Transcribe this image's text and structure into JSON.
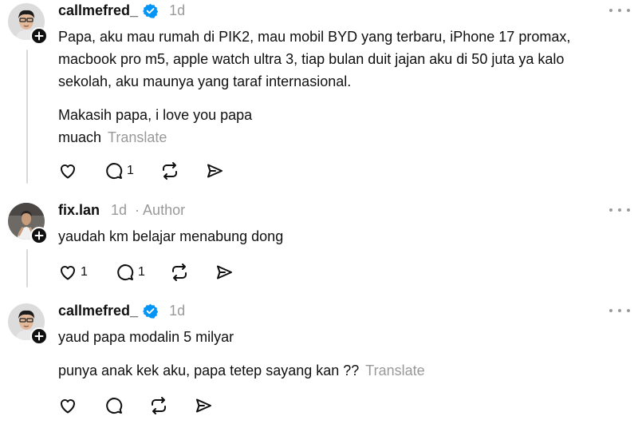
{
  "posts": [
    {
      "username": "callmefred_",
      "verified": true,
      "time": "1d",
      "author_tag": "",
      "paragraphs": [
        "Papa, aku mau rumah di PIK2, mau mobil BYD yang terbaru, iPhone 17 promax, macbook pro m5, apple watch ultra 3, tiap bulan duit jajan aku di 50 juta ya kalo sekolah, aku maunya yang taraf internasional.",
        "Makasih papa, i love you papa",
        "muach"
      ],
      "translate_label": "Translate",
      "likes": "",
      "replies": "1"
    },
    {
      "username": "fix.lan",
      "verified": false,
      "time": "1d",
      "author_tag": "· Author",
      "paragraphs": [
        "yaudah km belajar menabung dong"
      ],
      "translate_label": "",
      "likes": "1",
      "replies": "1"
    },
    {
      "username": "callmefred_",
      "verified": true,
      "time": "1d",
      "author_tag": "",
      "paragraphs": [
        "yaud papa modalin 5 milyar",
        "punya anak kek aku, papa tetep sayang kan ??"
      ],
      "translate_label": "Translate",
      "likes": "",
      "replies": ""
    }
  ],
  "icons": {
    "like": "heart-icon",
    "reply": "comment-icon",
    "repost": "repost-icon",
    "share": "send-icon",
    "more": "more-icon",
    "verified": "verified-badge-icon",
    "follow": "plus-icon"
  },
  "colors": {
    "text": "#101010",
    "muted": "#999999",
    "verified": "#0095f6",
    "thread_line": "#d9d9d9"
  }
}
